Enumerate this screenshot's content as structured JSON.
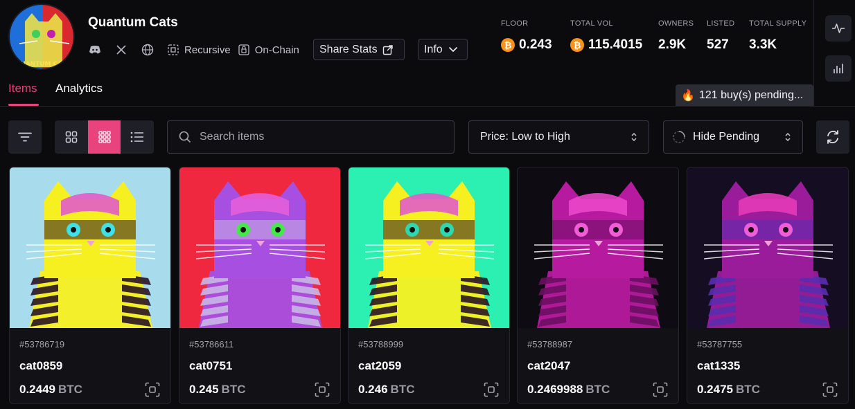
{
  "collection": {
    "name": "Quantum Cats",
    "avatar_text": "QUANTUM CATS",
    "social": [
      "discord-icon",
      "x-icon",
      "globe-icon"
    ],
    "tags": [
      {
        "icon": "recursive-icon",
        "label": "Recursive"
      },
      {
        "icon": "on-chain-icon",
        "label": "On-Chain"
      }
    ],
    "share_label": "Share Stats",
    "info_label": "Info"
  },
  "stats": [
    {
      "label": "FLOOR",
      "value": "0.243",
      "coin": true
    },
    {
      "label": "TOTAL VOL",
      "value": "115.4015",
      "coin": true
    },
    {
      "label": "OWNERS",
      "value": "2.9K",
      "coin": false
    },
    {
      "label": "LISTED",
      "value": "527",
      "coin": false
    },
    {
      "label": "TOTAL SUPPLY",
      "value": "3.3K",
      "coin": false
    }
  ],
  "side_buttons": [
    "activity-chart-icon",
    "bar-chart-icon"
  ],
  "tabs": [
    {
      "label": "Items",
      "active": true
    },
    {
      "label": "Analytics",
      "active": false
    }
  ],
  "pending": {
    "icon": "🔥",
    "text": "121 buy(s) pending..."
  },
  "toolbar": {
    "search_placeholder": "Search items",
    "sort_label": "Price: Low to High",
    "pending_filter_label": "Hide Pending",
    "active_view": "compact-grid"
  },
  "currency": "BTC",
  "colors": {
    "accent": "#e8437d",
    "btc": "#f7931a",
    "background": "#0b0a0d"
  },
  "items": [
    {
      "id": "#53786719",
      "name": "cat0859",
      "price": "0.2449",
      "bg": "#a8dcec",
      "head": "#f7f021",
      "accent": "#e15cc8",
      "eyes": "#3fe0e8",
      "stripes": "#2a1424"
    },
    {
      "id": "#53786611",
      "name": "cat0751",
      "price": "0.245",
      "bg": "#f0283f",
      "head": "#a64fe0",
      "accent": "#e65ed9",
      "eyes": "#44e84a",
      "stripes": "#c9b7e6"
    },
    {
      "id": "#53788999",
      "name": "cat2059",
      "price": "0.246",
      "bg": "#2bf0b2",
      "head": "#f7f021",
      "accent": "#e15cc8",
      "eyes": "#2dd7b0",
      "stripes": "#2a1424"
    },
    {
      "id": "#53788987",
      "name": "cat2047",
      "price": "0.2469988",
      "bg": "#0f0b12",
      "head": "#b61a9f",
      "accent": "#ea47c9",
      "eyes": "#f05dd6",
      "stripes": "#6a0f60"
    },
    {
      "id": "#53787755",
      "name": "cat1335",
      "price": "0.2475",
      "bg": "#150d22",
      "head": "#9a1c9a",
      "accent": "#e43bb8",
      "eyes": "#f05dd6",
      "stripes": "#5a2db0"
    }
  ]
}
